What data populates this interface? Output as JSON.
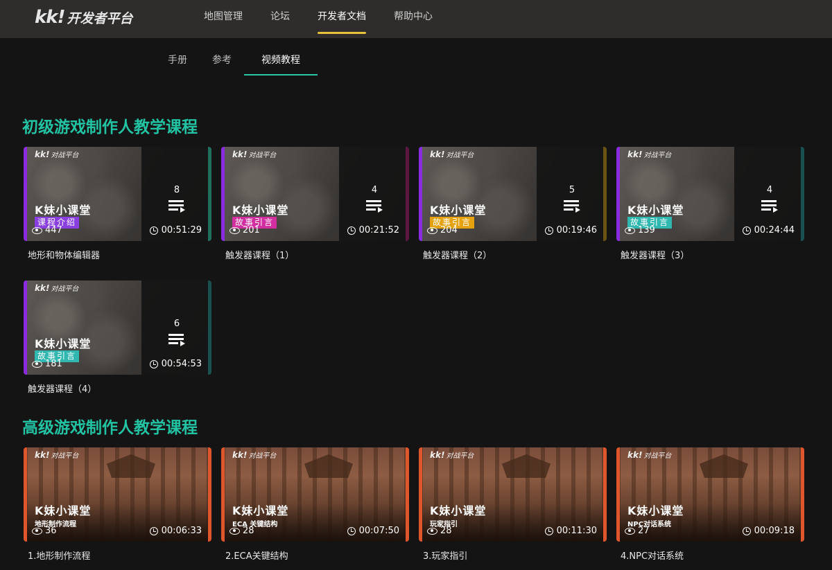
{
  "header": {
    "logo_mark": "kk!",
    "logo_text": "开发者平台",
    "nav": [
      "地图管理",
      "论坛",
      "开发者文档",
      "帮助中心"
    ],
    "active_nav": "开发者文档"
  },
  "subtabs": {
    "items": [
      "手册",
      "参考",
      "视频教程"
    ],
    "active": "视频教程"
  },
  "thumb_brand": {
    "mark": "kk!",
    "text": "对战平台"
  },
  "sections": [
    {
      "title": "初级游戏制作人教学课程",
      "courses": [
        {
          "title": "地形和物体编辑器",
          "thumb_title": "K妹小课堂",
          "tag": "课程介绍",
          "views": "447",
          "duration": "00:51:29",
          "count": "8"
        },
        {
          "title": "触发器课程（1）",
          "thumb_title": "K妹小课堂",
          "tag": "故事引言",
          "views": "201",
          "duration": "00:21:52",
          "count": "4"
        },
        {
          "title": "触发器课程（2）",
          "thumb_title": "K妹小课堂",
          "tag": "故事引言",
          "views": "204",
          "duration": "00:19:46",
          "count": "5"
        },
        {
          "title": "触发器课程（3）",
          "thumb_title": "K妹小课堂",
          "tag": "故事引言",
          "views": "139",
          "duration": "00:24:44",
          "count": "4"
        },
        {
          "title": "触发器课程（4）",
          "thumb_title": "K妹小课堂",
          "tag": "故事引言",
          "views": "181",
          "duration": "00:54:53",
          "count": "6"
        }
      ]
    },
    {
      "title": "高级游戏制作人教学课程",
      "courses": [
        {
          "title": "1.地形制作流程",
          "thumb_title": "K妹小课堂",
          "sub": "地形制作流程",
          "views": "36",
          "duration": "00:06:33"
        },
        {
          "title": "2.ECA关键结构",
          "thumb_title": "K妹小课堂",
          "sub": "ECA 关键结构",
          "views": "28",
          "duration": "00:07:50"
        },
        {
          "title": "3.玩家指引",
          "thumb_title": "K妹小课堂",
          "sub": "玩家指引",
          "views": "28",
          "duration": "00:11:30"
        },
        {
          "title": "4.NPC对话系统",
          "thumb_title": "K妹小课堂",
          "sub": "NPC对话系统",
          "views": "27",
          "duration": "00:09:18"
        }
      ]
    }
  ],
  "colors": {
    "accent": "#22c3a3",
    "nav_underline": "#e8c23a",
    "tag_intro": "#8a3fe0",
    "tag_story_1": "#d12fa0",
    "tag_story_2": "#e5a20c",
    "tag_story_3": "#2fb7b0"
  }
}
